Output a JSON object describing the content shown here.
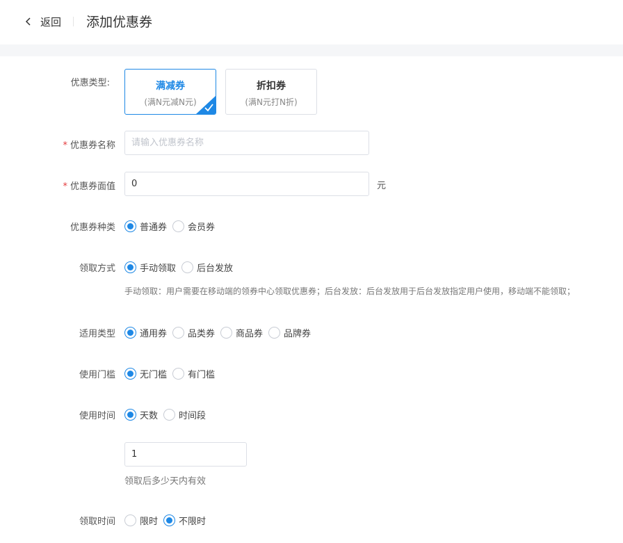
{
  "header": {
    "back_label": "返回",
    "title": "添加优惠券"
  },
  "colors": {
    "accent": "#1e88e5",
    "required": "#e4393c",
    "band": "#f5f6f8"
  },
  "form": {
    "coupon_type": {
      "label": "优惠类型:",
      "options": [
        {
          "title": "满减券",
          "subtitle": "(满N元减N元)",
          "selected": true
        },
        {
          "title": "折扣券",
          "subtitle": "(满N元打N折)",
          "selected": false
        }
      ]
    },
    "coupon_name": {
      "label": "优惠券名称",
      "value": "",
      "placeholder": "请输入优惠券名称"
    },
    "face_value": {
      "label": "优惠券面值",
      "value": "0",
      "unit": "元"
    },
    "coupon_kind": {
      "label": "优惠券种类",
      "options": [
        "普通券",
        "会员券"
      ],
      "selected": "普通券"
    },
    "claim_method": {
      "label": "领取方式",
      "options": [
        "手动领取",
        "后台发放"
      ],
      "selected": "手动领取",
      "hint": "手动领取：用户需要在移动端的领券中心领取优惠券；后台发放：后台发放用于后台发放指定用户使用，移动端不能领取；"
    },
    "applicable_type": {
      "label": "适用类型",
      "options": [
        "通用券",
        "品类券",
        "商品券",
        "品牌券"
      ],
      "selected": "通用券"
    },
    "threshold": {
      "label": "使用门槛",
      "options": [
        "无门槛",
        "有门槛"
      ],
      "selected": "无门槛"
    },
    "usage_time": {
      "label": "使用时间",
      "options": [
        "天数",
        "时间段"
      ],
      "selected": "天数",
      "days_value": "1",
      "days_hint": "领取后多少天内有效"
    },
    "claim_time": {
      "label": "领取时间",
      "options": [
        "限时",
        "不限时"
      ],
      "selected": "不限时"
    }
  }
}
